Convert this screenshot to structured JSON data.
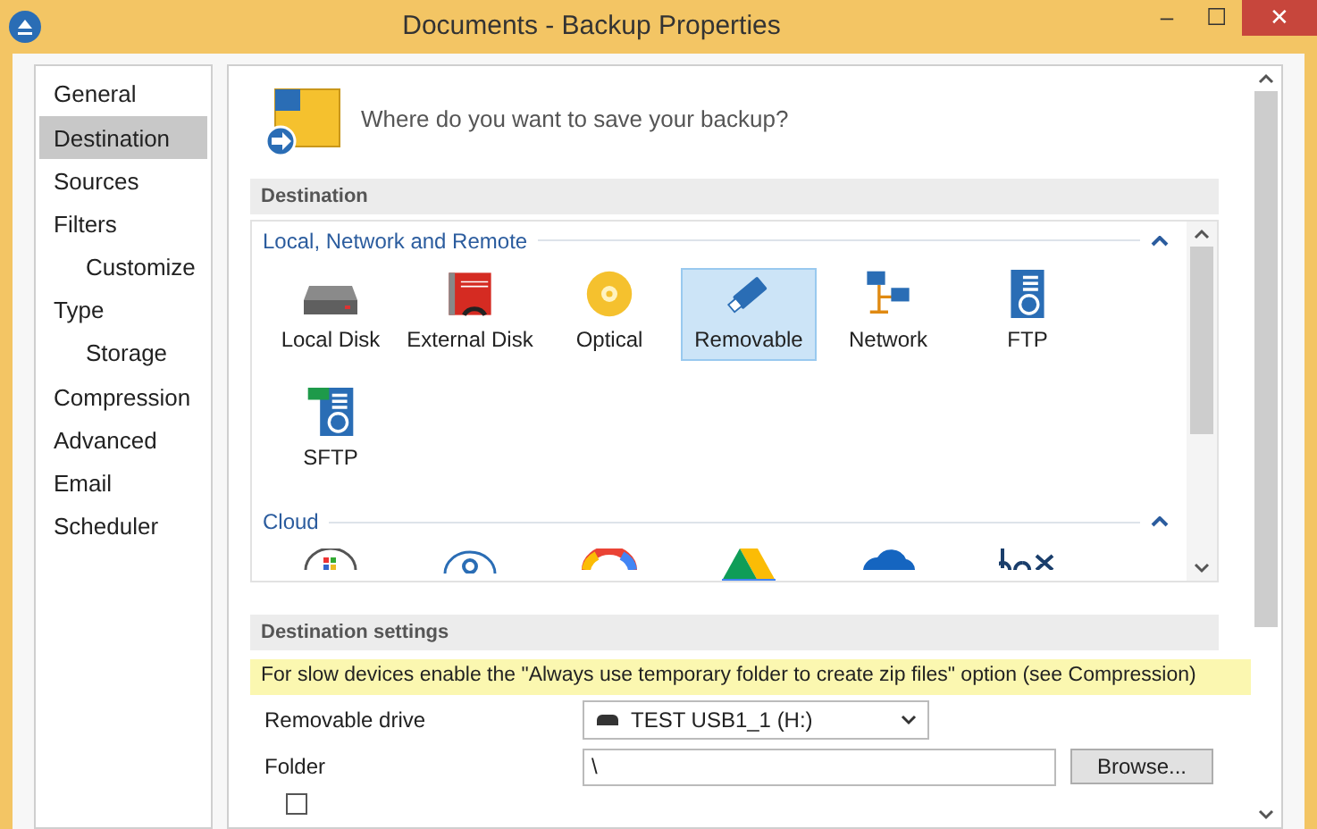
{
  "window": {
    "title": "Documents - Backup Properties",
    "buttons": [
      "–",
      "☐",
      "✕"
    ]
  },
  "sidebar": {
    "items": [
      {
        "label": "General",
        "selected": false
      },
      {
        "label": "Destination",
        "selected": true
      },
      {
        "label": "Sources",
        "selected": false
      },
      {
        "label": "Filters",
        "selected": false,
        "children": [
          {
            "label": "Customize",
            "selected": false
          }
        ]
      },
      {
        "label": "Type",
        "selected": false,
        "children": [
          {
            "label": "Storage",
            "selected": false
          }
        ]
      },
      {
        "label": "Compression",
        "selected": false
      },
      {
        "label": "Advanced",
        "selected": false
      },
      {
        "label": "Email",
        "selected": false
      },
      {
        "label": "Scheduler",
        "selected": false
      }
    ]
  },
  "header": {
    "prompt": "Where do you want to save your backup?"
  },
  "destination": {
    "title": "Destination",
    "groups": [
      {
        "title": "Local, Network and Remote",
        "expanded": true,
        "items": [
          {
            "kind": "local-disk",
            "label": "Local Disk",
            "selected": false
          },
          {
            "kind": "external-disk",
            "label": "External Disk",
            "selected": false
          },
          {
            "kind": "optical",
            "label": "Optical",
            "selected": false
          },
          {
            "kind": "removable",
            "label": "Removable",
            "selected": true
          },
          {
            "kind": "network",
            "label": "Network",
            "selected": false
          },
          {
            "kind": "ftp",
            "label": "FTP",
            "selected": false
          },
          {
            "kind": "sftp",
            "label": "SFTP",
            "selected": false
          }
        ]
      },
      {
        "title": "Cloud",
        "expanded": true,
        "items": [
          {
            "kind": "cloud-windows"
          },
          {
            "kind": "cloud-amazon"
          },
          {
            "kind": "cloud-google"
          },
          {
            "kind": "drive"
          },
          {
            "kind": "onedrive"
          },
          {
            "kind": "box"
          }
        ]
      }
    ]
  },
  "settings": {
    "title": "Destination settings",
    "note": "For slow devices enable the \"Always use temporary folder to create zip files\" option (see Compression)",
    "drive": {
      "label": "Removable drive",
      "value": "TEST USB1_1 (H:)"
    },
    "folder": {
      "label": "Folder",
      "value": "\\",
      "button": "Browse..."
    },
    "lock": {
      "checked": false
    }
  }
}
